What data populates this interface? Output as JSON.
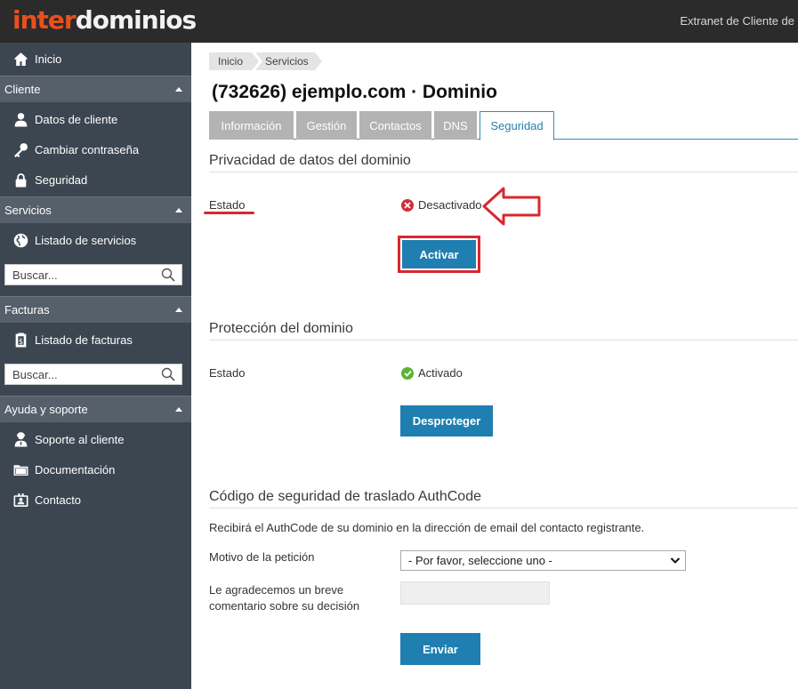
{
  "header": {
    "logo_part1": "inter",
    "logo_part2": "dominios",
    "extranet_label": "Extranet de Cliente de",
    "colors": {
      "background": "#2b2b2b",
      "logo_accent": "#e8501f"
    }
  },
  "sidebar": {
    "home": {
      "label": "Inicio",
      "icon": "home-icon"
    },
    "sections": [
      {
        "title": "Cliente",
        "items": [
          {
            "label": "Datos de cliente",
            "icon": "user-icon"
          },
          {
            "label": "Cambiar contraseña",
            "icon": "key-icon"
          },
          {
            "label": "Seguridad",
            "icon": "lock-icon"
          }
        ]
      },
      {
        "title": "Servicios",
        "items": [
          {
            "label": "Listado de servicios",
            "icon": "globe-icon"
          }
        ],
        "search_placeholder": "Buscar..."
      },
      {
        "title": "Facturas",
        "items": [
          {
            "label": "Listado de facturas",
            "icon": "invoice-icon"
          }
        ],
        "search_placeholder": "Buscar..."
      },
      {
        "title": "Ayuda y soporte",
        "items": [
          {
            "label": "Soporte al cliente",
            "icon": "support-icon"
          },
          {
            "label": "Documentación",
            "icon": "folder-icon"
          },
          {
            "label": "Contacto",
            "icon": "contact-card-icon"
          }
        ]
      }
    ],
    "colors": {
      "background": "#3c4650",
      "section_header": "#56606a"
    }
  },
  "breadcrumb": [
    "Inicio",
    "Servicios"
  ],
  "page_title": "(732626) ejemplo.com · Dominio",
  "tabs": [
    {
      "label": "Información",
      "active": false
    },
    {
      "label": "Gestión",
      "active": false
    },
    {
      "label": "Contactos",
      "active": false
    },
    {
      "label": "DNS",
      "active": false
    },
    {
      "label": "Seguridad",
      "active": true
    }
  ],
  "privacy": {
    "title": "Privacidad de datos del dominio",
    "status_label": "Estado",
    "status_value": "Desactivado",
    "status_icon": "error-circle-icon",
    "button": "Activar"
  },
  "protection": {
    "title": "Protección del dominio",
    "status_label": "Estado",
    "status_value": "Activado",
    "status_icon": "check-circle-icon",
    "button": "Desproteger"
  },
  "authcode": {
    "title": "Código de seguridad de traslado AuthCode",
    "description": "Recibirá el AuthCode de su dominio en la dirección de email del contacto registrante.",
    "reason_label": "Motivo de la petición",
    "reason_selected": "- Por favor, seleccione uno -",
    "comment_label_line1": "Le agradecemos un breve",
    "comment_label_line2": "comentario sobre su decisión",
    "comment_value": "",
    "button": "Enviar"
  },
  "colors": {
    "primary_button": "#1e7fb0",
    "annotation_red": "#d9272e",
    "tab_inactive": "#b3b3b3"
  }
}
